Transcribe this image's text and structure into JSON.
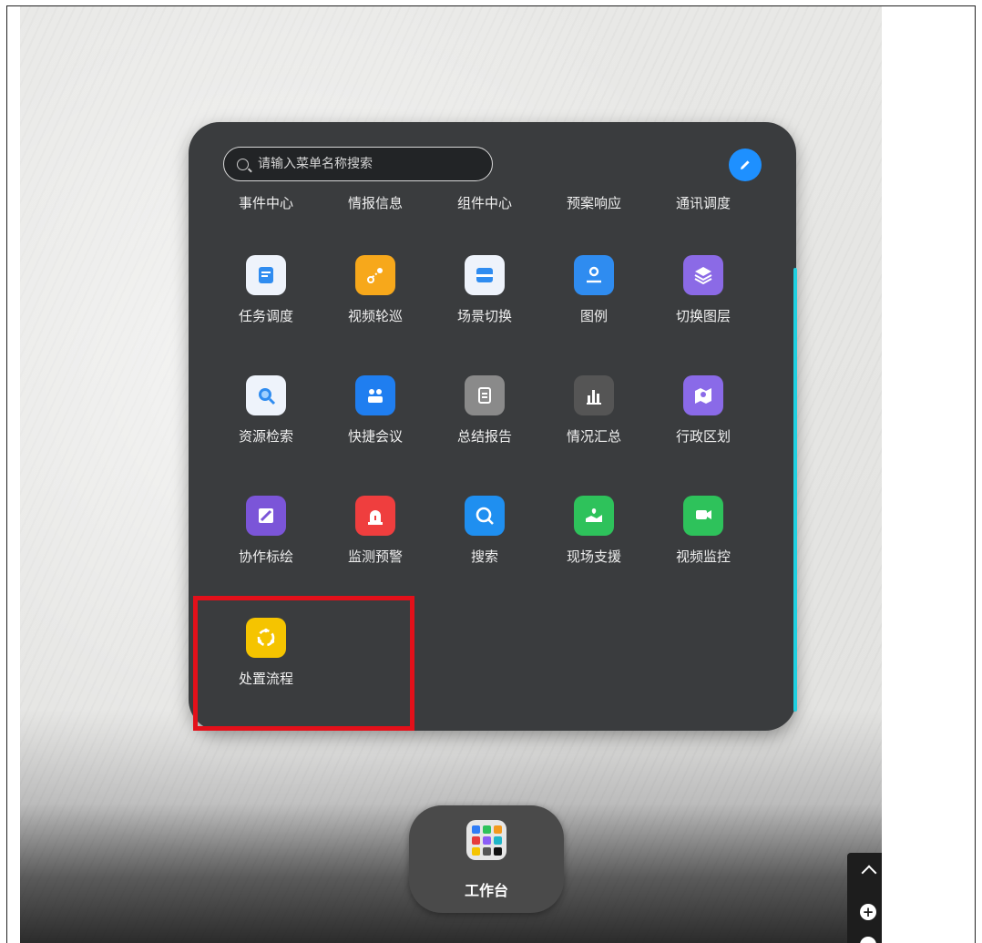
{
  "search": {
    "placeholder": "请输入菜单名称搜索"
  },
  "tabs": [
    "事件中心",
    "情报信息",
    "组件中心",
    "预案响应",
    "通讯调度"
  ],
  "rows": [
    [
      {
        "label": "任务调度",
        "icon": "task-dispatch-icon",
        "color": "#eef3fb"
      },
      {
        "label": "视频轮巡",
        "icon": "video-patrol-icon",
        "color": "#f7a81b"
      },
      {
        "label": "场景切换",
        "icon": "scene-switch-icon",
        "color": "#eef3fb"
      },
      {
        "label": "图例",
        "icon": "legend-icon",
        "color": "#2f8cf0"
      },
      {
        "label": "切换图层",
        "icon": "layers-icon",
        "color": "#8b6ae6"
      }
    ],
    [
      {
        "label": "资源检索",
        "icon": "resource-search-icon",
        "color": "#eef3fb"
      },
      {
        "label": "快捷会议",
        "icon": "quick-meeting-icon",
        "color": "#1f7ef0"
      },
      {
        "label": "总结报告",
        "icon": "summary-report-icon",
        "color": "#8a8a8a"
      },
      {
        "label": "情况汇总",
        "icon": "situation-summary-icon",
        "color": "#555555"
      },
      {
        "label": "行政区划",
        "icon": "admin-region-icon",
        "color": "#8a6ae8"
      }
    ],
    [
      {
        "label": "协作标绘",
        "icon": "collab-draw-icon",
        "color": "#7b55d8"
      },
      {
        "label": "监测预警",
        "icon": "monitor-alarm-icon",
        "color": "#ef3e3e"
      },
      {
        "label": "搜索",
        "icon": "search-icon",
        "color": "#1f8ff0"
      },
      {
        "label": "现场支援",
        "icon": "field-support-icon",
        "color": "#2ec25b"
      },
      {
        "label": "视频监控",
        "icon": "video-monitor-icon",
        "color": "#2ec25b"
      }
    ],
    [
      {
        "label": "处置流程",
        "icon": "disposal-flow-icon",
        "color": "#f5c400"
      }
    ]
  ],
  "dock": {
    "label": "工作台",
    "icon": "app-grid-icon"
  },
  "colors": {
    "panel": "#3a3c3e",
    "accent_blue": "#1e90ff",
    "scrollbar": "#20d0e0",
    "highlight": "#e3101a"
  }
}
